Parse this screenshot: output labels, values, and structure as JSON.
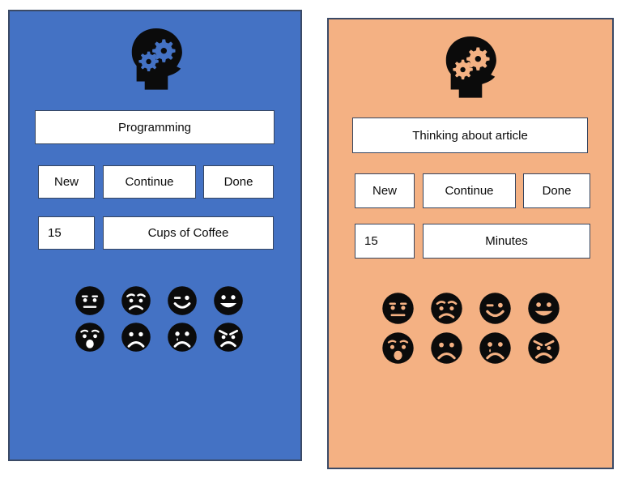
{
  "app": {
    "title": "Mind Tracker Mockup",
    "panels": [
      {
        "id": "panel-programming",
        "theme_color": "#4472C4",
        "border_color": "#3b4a66",
        "icon": "head-gears-icon",
        "activity_value": "Programming",
        "actions": [
          {
            "id": "new",
            "label": "New"
          },
          {
            "id": "continue",
            "label": "Continue"
          },
          {
            "id": "done",
            "label": "Done"
          }
        ],
        "metric": {
          "amount": "15",
          "unit": "Cups of Coffee"
        },
        "moods": [
          {
            "id": "neutral",
            "name": "neutral-face-icon"
          },
          {
            "id": "frowning",
            "name": "frowning-face-icon"
          },
          {
            "id": "wink",
            "name": "winking-face-icon"
          },
          {
            "id": "grin",
            "name": "grinning-face-icon"
          },
          {
            "id": "surprised",
            "name": "surprised-face-icon"
          },
          {
            "id": "sad",
            "name": "sad-face-icon"
          },
          {
            "id": "crying",
            "name": "crying-face-icon"
          },
          {
            "id": "angry",
            "name": "angry-face-icon"
          }
        ]
      },
      {
        "id": "panel-article",
        "theme_color": "#F4B183",
        "border_color": "#3b4a66",
        "icon": "head-gears-icon",
        "activity_value": "Thinking about article",
        "actions": [
          {
            "id": "new",
            "label": "New"
          },
          {
            "id": "continue",
            "label": "Continue"
          },
          {
            "id": "done",
            "label": "Done"
          }
        ],
        "metric": {
          "amount": "15",
          "unit": "Minutes"
        },
        "moods": [
          {
            "id": "neutral",
            "name": "neutral-face-icon"
          },
          {
            "id": "frowning",
            "name": "frowning-face-icon"
          },
          {
            "id": "wink",
            "name": "winking-face-icon"
          },
          {
            "id": "grin",
            "name": "grinning-face-icon"
          },
          {
            "id": "surprised",
            "name": "surprised-face-icon"
          },
          {
            "id": "sad",
            "name": "sad-face-icon"
          },
          {
            "id": "crying",
            "name": "crying-face-icon"
          },
          {
            "id": "angry",
            "name": "angry-face-icon"
          }
        ]
      }
    ]
  }
}
